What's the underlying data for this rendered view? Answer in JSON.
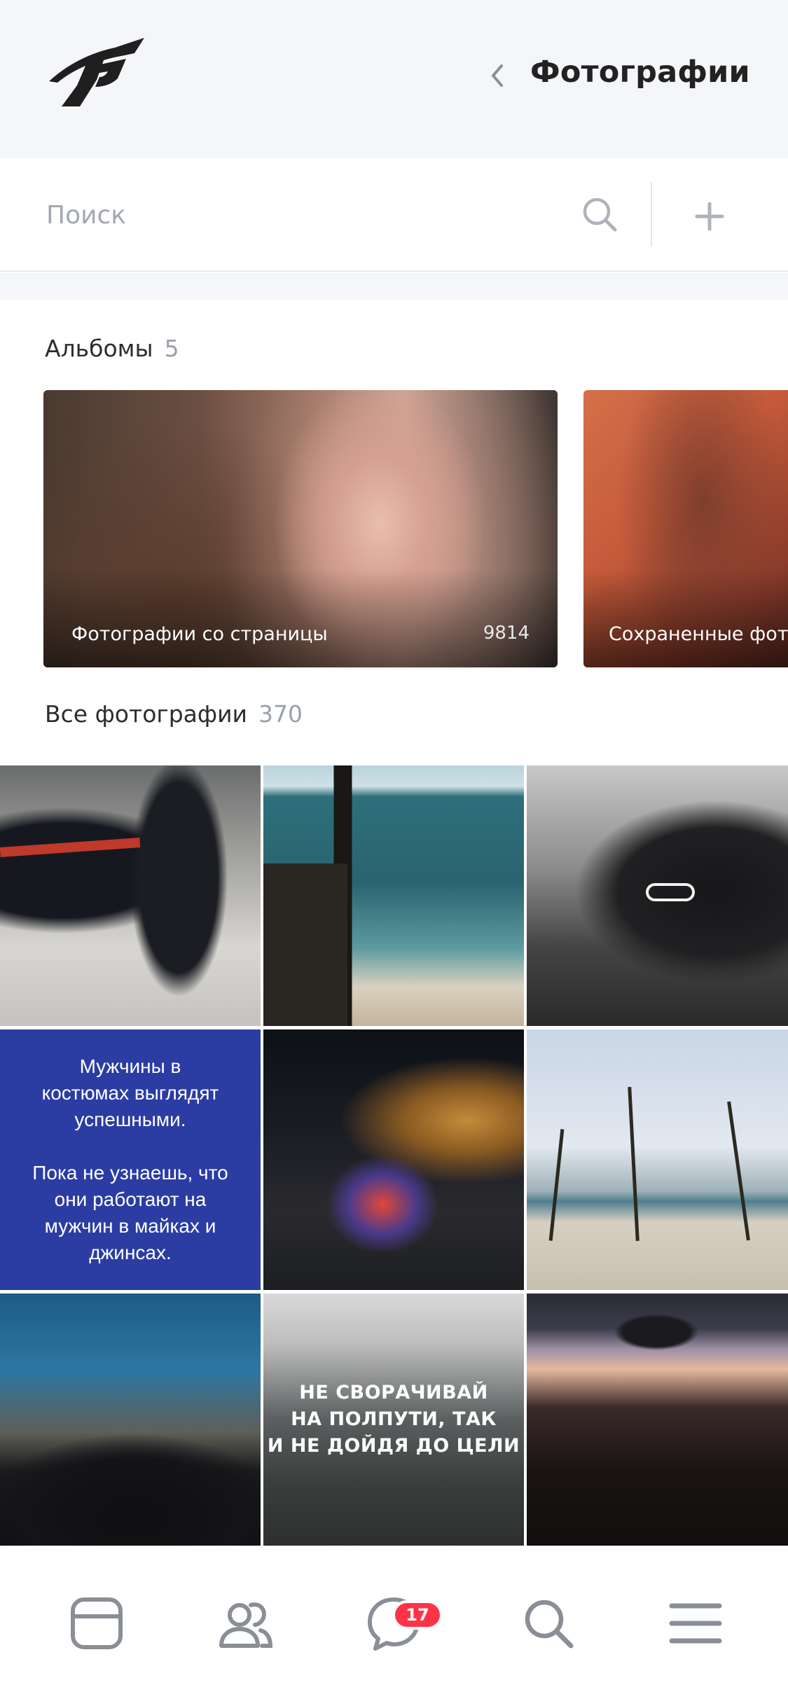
{
  "header": {
    "title": "Фотографии",
    "logo_icon": "brand-logo-icon",
    "back_icon": "chevron-left-icon"
  },
  "search": {
    "placeholder": "Поиск",
    "value": "",
    "search_icon": "search-icon",
    "add_icon": "plus-icon"
  },
  "albums": {
    "title": "Альбомы",
    "count": "5",
    "items": [
      {
        "label": "Фотографии со страницы",
        "count": "9814"
      },
      {
        "label": "Сохраненные фотографии",
        "count": ""
      }
    ]
  },
  "photos": {
    "title": "Все фотографии",
    "count": "370",
    "tiles": [
      {
        "text": ""
      },
      {
        "text": ""
      },
      {
        "text": ""
      },
      {
        "text": "Мужчины в\nкостюмах выглядят\nуспешными.\n\nПока не узнаешь, что\nони работают на\nмужчин в майках и\nджинсах."
      },
      {
        "text": ""
      },
      {
        "text": ""
      },
      {
        "text": ""
      },
      {
        "text": "НЕ СВОРАЧИВАЙ\nНА ПОЛПУТИ, ТАК\nИ НЕ ДОЙДЯ ДО ЦЕЛИ"
      },
      {
        "text": ""
      }
    ]
  },
  "bottom_nav": {
    "items": [
      {
        "icon": "news-feed-icon"
      },
      {
        "icon": "friends-icon"
      },
      {
        "icon": "messages-icon",
        "badge": "17"
      },
      {
        "icon": "search-icon"
      },
      {
        "icon": "menu-icon"
      }
    ]
  },
  "colors": {
    "header_bg": "#f5f6f9",
    "accent_badge": "#ff3347",
    "muted_text": "#99a0a8",
    "icon_gray": "#8a8f96"
  }
}
